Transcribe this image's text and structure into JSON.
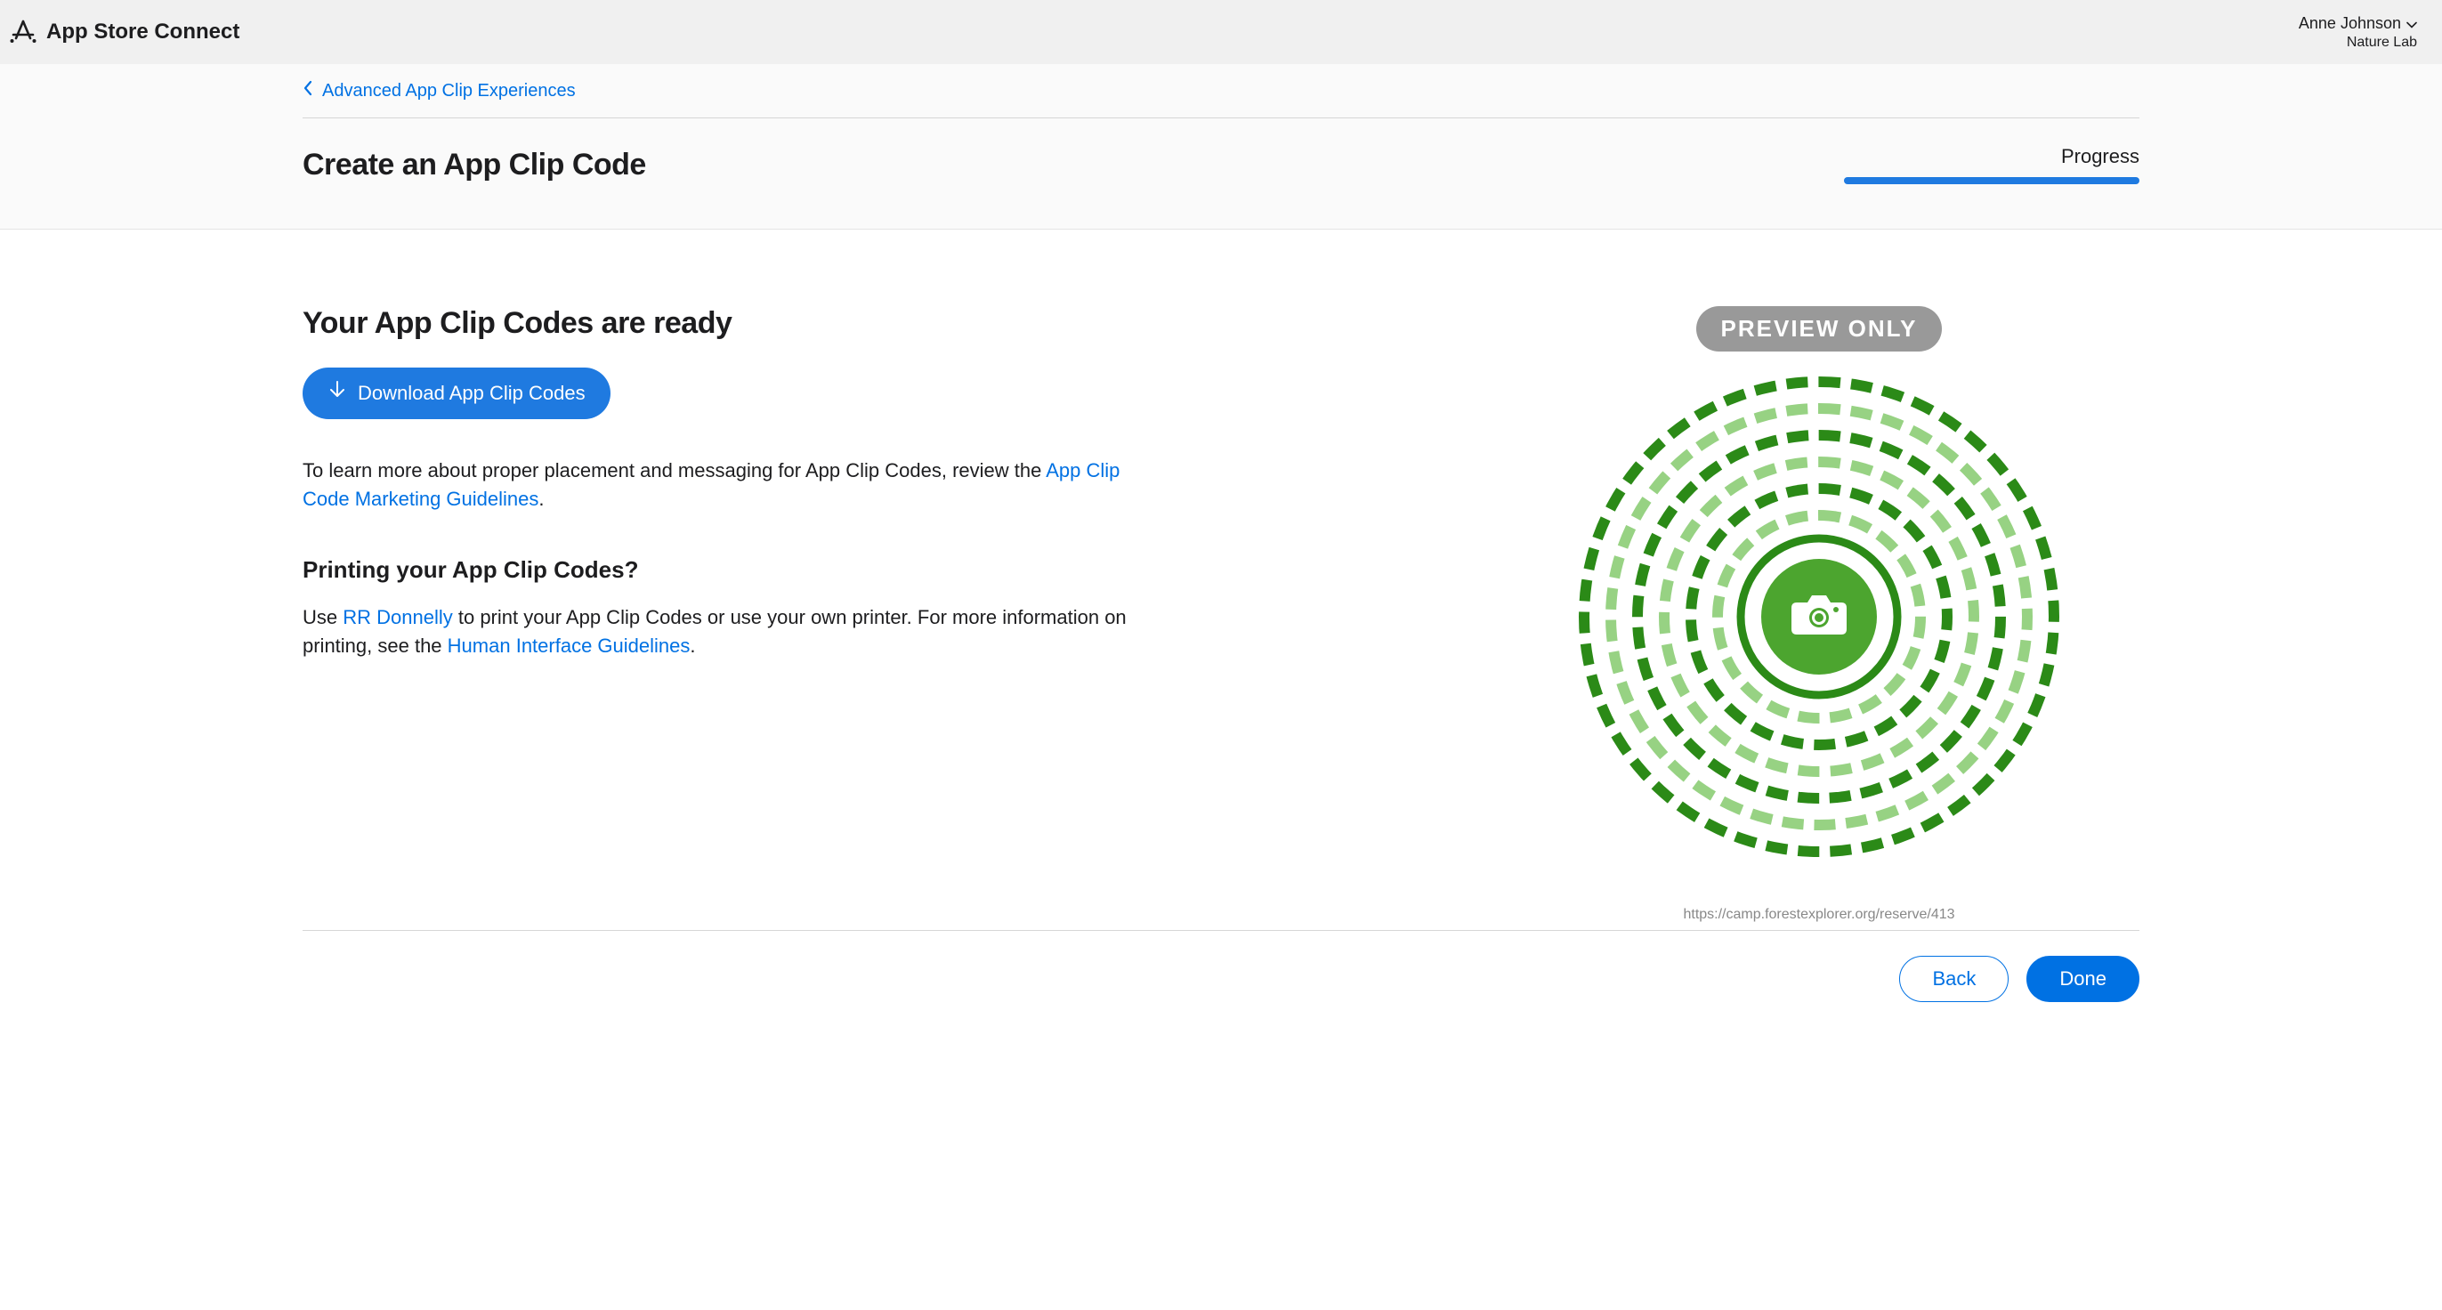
{
  "header": {
    "app_name": "App Store Connect",
    "user_name": "Anne Johnson",
    "team_name": "Nature Lab"
  },
  "breadcrumb": {
    "back_label": "Advanced App Clip Experiences"
  },
  "page": {
    "title": "Create an App Clip Code",
    "progress_label": "Progress"
  },
  "content": {
    "ready_heading": "Your App Clip Codes are ready",
    "download_button": "Download App Clip Codes",
    "learn_more_prefix": "To learn more about proper placement and messaging for App Clip Codes, review the ",
    "guidelines_link": "App Clip Code Marketing Guidelines",
    "guidelines_suffix": ".",
    "printing_heading": "Printing your App Clip Codes?",
    "rr_prefix": "Use ",
    "rr_link": "RR Donnelly",
    "rr_middle": " to print your App Clip Codes or use your own printer. For more information on printing, see the ",
    "hig_link": "Human Interface Guidelines",
    "hig_suffix": "."
  },
  "preview": {
    "badge": "PREVIEW ONLY",
    "url": "https://camp.forestexplorer.org/reserve/413",
    "colors": {
      "dark_green": "#2b8a17",
      "light_green": "#97d283",
      "center": "#4ca52f"
    }
  },
  "footer": {
    "back_button": "Back",
    "done_button": "Done"
  }
}
